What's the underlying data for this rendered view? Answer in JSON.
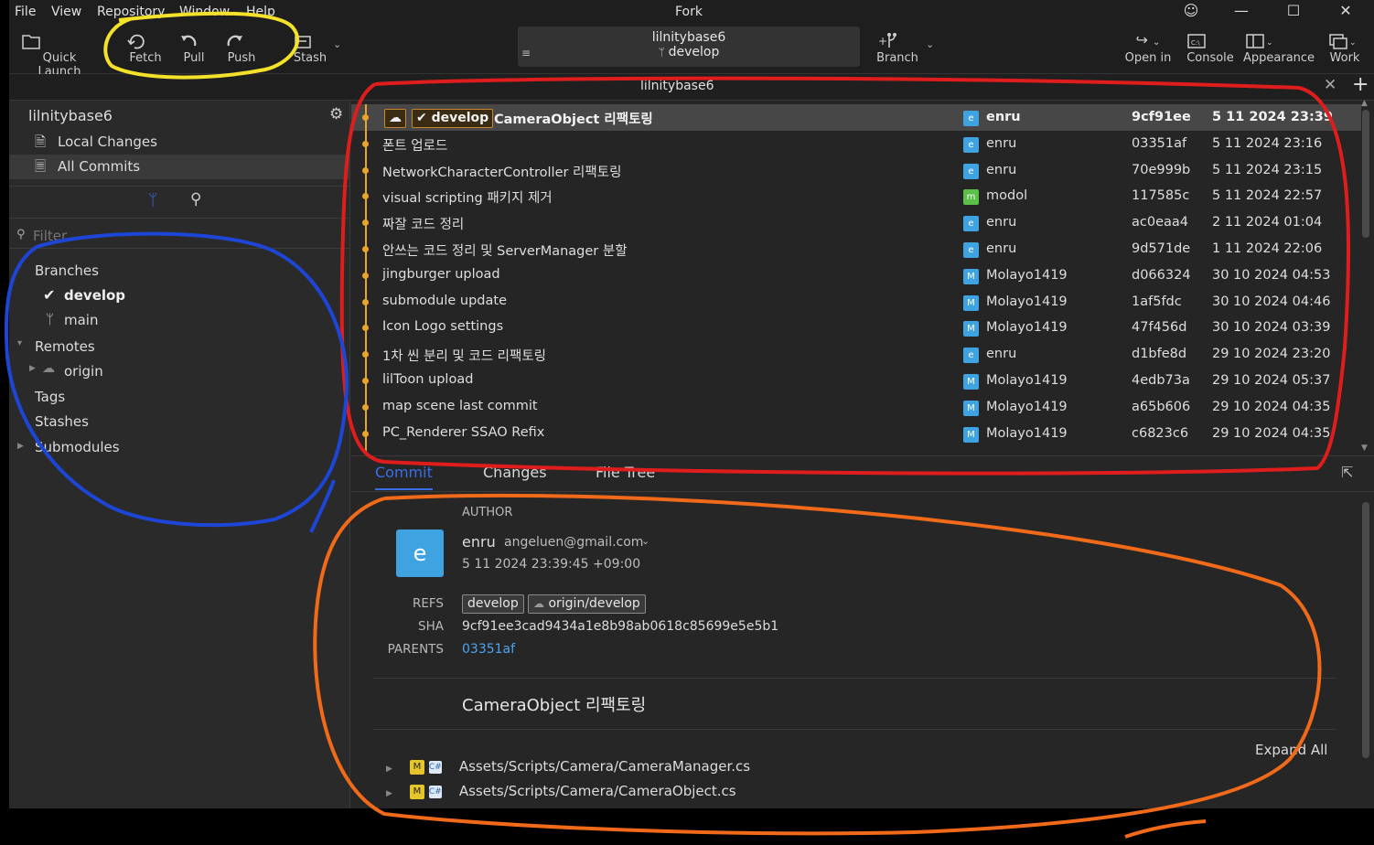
{
  "menu": [
    "File",
    "View",
    "Repository",
    "Window",
    "Help"
  ],
  "app_title": "Fork",
  "toolbar": {
    "quick_launch": "Quick Launch",
    "fetch": "Fetch",
    "pull": "Pull",
    "push": "Push",
    "stash": "Stash",
    "repo_name": "lilnitybase6",
    "branch_name": "develop",
    "branch": "Branch",
    "open_in": "Open in",
    "console": "Console",
    "appearance": "Appearance",
    "work": "Work"
  },
  "tab": {
    "title": "lilnitybase6"
  },
  "sidebar": {
    "repo": "lilnitybase6",
    "local_changes": "Local Changes",
    "all_commits": "All Commits",
    "filter_placeholder": "Filter",
    "branches": "Branches",
    "branch_develop": "develop",
    "branch_main": "main",
    "remotes": "Remotes",
    "origin": "origin",
    "tags": "Tags",
    "stashes": "Stashes",
    "submodules": "Submodules"
  },
  "commits": [
    {
      "msg": "CameraObject 리팩토링",
      "author": "enru",
      "avatar": "e",
      "sha": "9cf91ee",
      "date": "5 11 2024 23:39"
    },
    {
      "msg": "폰트 업로드",
      "author": "enru",
      "avatar": "e",
      "sha": "03351af",
      "date": "5 11 2024 23:16"
    },
    {
      "msg": "NetworkCharacterController 리팩토링",
      "author": "enru",
      "avatar": "e",
      "sha": "70e999b",
      "date": "5 11 2024 23:15"
    },
    {
      "msg": "visual scripting 패키지 제거",
      "author": "modol",
      "avatar": "m",
      "sha": "117585c",
      "date": "5 11 2024 22:57"
    },
    {
      "msg": "짜잘 코드 정리",
      "author": "enru",
      "avatar": "e",
      "sha": "ac0eaa4",
      "date": "2 11 2024 01:04"
    },
    {
      "msg": "안쓰는 코드 정리 및 ServerManager 분할",
      "author": "enru",
      "avatar": "e",
      "sha": "9d571de",
      "date": "1 11 2024 22:06"
    },
    {
      "msg": "jingburger upload",
      "author": "Molayo1419",
      "avatar": "M",
      "sha": "d066324",
      "date": "30 10 2024 04:53"
    },
    {
      "msg": "submodule update",
      "author": "Molayo1419",
      "avatar": "M",
      "sha": "1af5fdc",
      "date": "30 10 2024 04:46"
    },
    {
      "msg": "Icon Logo settings",
      "author": "Molayo1419",
      "avatar": "M",
      "sha": "47f456d",
      "date": "30 10 2024 03:39"
    },
    {
      "msg": "1차 씬 분리 및 코드 리팩토링",
      "author": "enru",
      "avatar": "e",
      "sha": "d1bfe8d",
      "date": "29 10 2024 23:20"
    },
    {
      "msg": "lilToon upload",
      "author": "Molayo1419",
      "avatar": "M",
      "sha": "4edb73a",
      "date": "29 10 2024 05:37"
    },
    {
      "msg": "map scene last commit",
      "author": "Molayo1419",
      "avatar": "M",
      "sha": "a65b606",
      "date": "29 10 2024 04:35"
    },
    {
      "msg": "PC_Renderer SSAO Refix",
      "author": "Molayo1419",
      "avatar": "M",
      "sha": "c6823c6",
      "date": "29 10 2024 04:35"
    }
  ],
  "head_badge": "develop",
  "detail": {
    "tab_commit": "Commit",
    "tab_changes": "Changes",
    "tab_file_tree": "File Tree",
    "author_label": "AUTHOR",
    "avatar_letter": "e",
    "author_name": "enru",
    "author_email": "angeluen@gmail.com",
    "author_date": "5 11 2024 23:39:45 +09:00",
    "refs_label": "REFS",
    "ref1": "develop",
    "ref2": "origin/develop",
    "sha_label": "SHA",
    "sha_full": "9cf91ee3cad9434a1e8b98ab0618c85699e5e5b1",
    "parents_label": "PARENTS",
    "parent": "03351af",
    "commit_message": "CameraObject 리팩토링",
    "expand_all": "Expand All",
    "files": [
      "Assets/Scripts/Camera/CameraManager.cs",
      "Assets/Scripts/Camera/CameraObject.cs"
    ]
  },
  "colors": {
    "accent_orange": "#e9a52a",
    "avatar_blue": "#3ea3e0",
    "avatar_green": "#5cbf4a",
    "link_blue": "#4ea3f0"
  }
}
